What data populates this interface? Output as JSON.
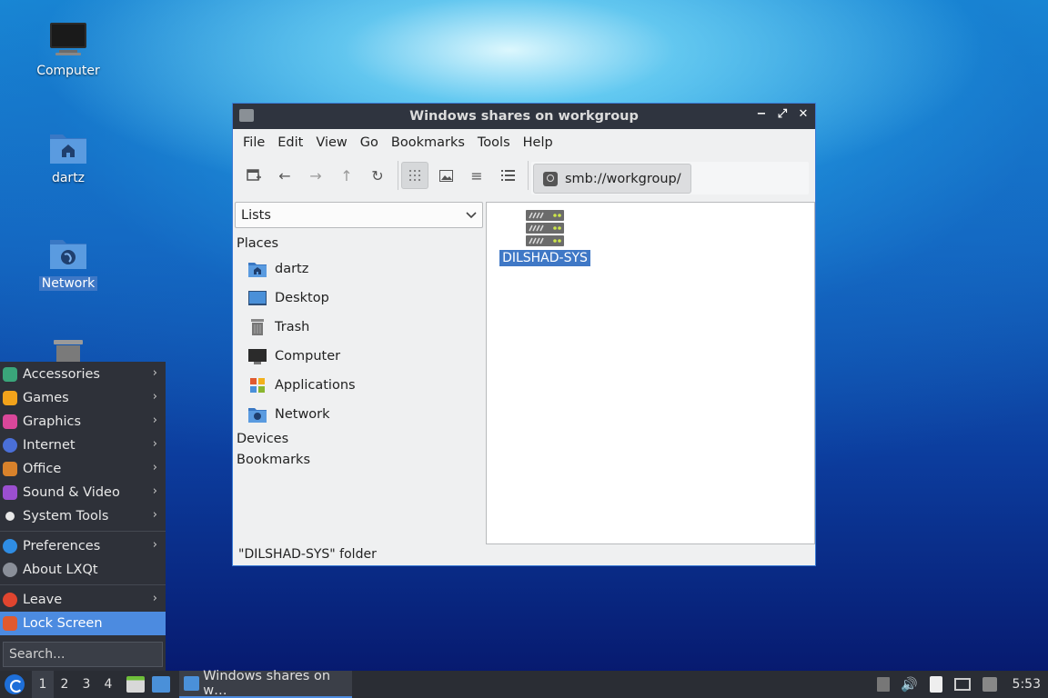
{
  "desktop": {
    "icons": [
      {
        "label": "Computer"
      },
      {
        "label": "dartz"
      },
      {
        "label": "Network"
      }
    ]
  },
  "window": {
    "title": "Windows shares on workgroup",
    "controls": {
      "minimize": "−",
      "maximize": "⤢",
      "close": "✕"
    },
    "menu": [
      "File",
      "Edit",
      "View",
      "Go",
      "Bookmarks",
      "Tools",
      "Help"
    ],
    "path": "smb://workgroup/",
    "side_mode": "Lists",
    "places_heading": "Places",
    "places": [
      {
        "label": "dartz",
        "icon": "home-folder-icon"
      },
      {
        "label": "Desktop",
        "icon": "desktop-icon"
      },
      {
        "label": "Trash",
        "icon": "trash-icon"
      },
      {
        "label": "Computer",
        "icon": "computer-icon"
      },
      {
        "label": "Applications",
        "icon": "applications-icon"
      },
      {
        "label": "Network",
        "icon": "network-icon"
      }
    ],
    "devices_heading": "Devices",
    "bookmarks_heading": "Bookmarks",
    "files": [
      {
        "label": "DILSHAD-SYS",
        "icon": "server-icon",
        "selected": true
      }
    ],
    "status": "\"DILSHAD-SYS\" folder"
  },
  "start_menu": {
    "items": [
      {
        "label": "Accessories",
        "color": "#3aa57a",
        "submenu": true
      },
      {
        "label": "Games",
        "color": "#f2a31b",
        "submenu": true
      },
      {
        "label": "Graphics",
        "color": "#d9479a",
        "submenu": true
      },
      {
        "label": "Internet",
        "color": "#4a6fd8",
        "submenu": true
      },
      {
        "label": "Office",
        "color": "#d9822b",
        "submenu": true
      },
      {
        "label": "Sound & Video",
        "color": "#9b4fd0",
        "submenu": true
      },
      {
        "label": "System Tools",
        "color": "#e8e8e8",
        "submenu": true
      }
    ],
    "items2": [
      {
        "label": "Preferences",
        "color": "#2f8de4",
        "submenu": true
      },
      {
        "label": "About LXQt",
        "color": "#8a8f99",
        "submenu": false
      }
    ],
    "items3": [
      {
        "label": "Leave",
        "color": "#e0452f",
        "submenu": true
      },
      {
        "label": "Lock Screen",
        "color": "#e05a2f",
        "submenu": false
      }
    ],
    "search_placeholder": "Search..."
  },
  "taskbar": {
    "desktops": [
      "1",
      "2",
      "3",
      "4"
    ],
    "active_desktop": "1",
    "task_label": "Windows shares on w…",
    "clock": "5:53"
  }
}
